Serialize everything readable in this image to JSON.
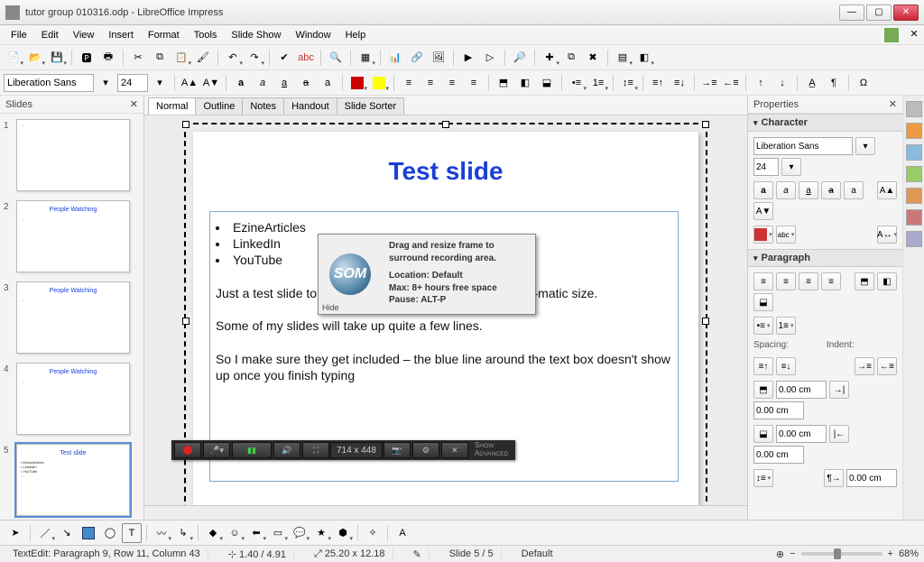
{
  "window": {
    "title": "tutor group 010316.odp - LibreOffice Impress"
  },
  "menu": [
    "File",
    "Edit",
    "View",
    "Insert",
    "Format",
    "Tools",
    "Slide Show",
    "Window",
    "Help"
  ],
  "format_toolbar": {
    "font": "Liberation Sans",
    "size": "24"
  },
  "slides_panel": {
    "title": "Slides"
  },
  "thumbs": [
    {
      "num": "1",
      "title": "",
      "body": ""
    },
    {
      "num": "2",
      "title": "People Watching",
      "body": ""
    },
    {
      "num": "3",
      "title": "People Watching",
      "body": ""
    },
    {
      "num": "4",
      "title": "People Watching",
      "body": ""
    },
    {
      "num": "5",
      "title": "Test slide",
      "body": "",
      "selected": true
    }
  ],
  "view_tabs": [
    "Normal",
    "Outline",
    "Notes",
    "Handout",
    "Slide Sorter"
  ],
  "active_view": "Normal",
  "slide": {
    "title": "Test slide",
    "bullets": [
      "EzineArticles",
      "LinkedIn",
      "YouTube"
    ],
    "para1": "Just a test slide to show you the size of the Screencast-o-matic size.",
    "para2": "Some of my slides will take up quite a few lines.",
    "para3": "So I make sure they get included – the blue line around the text box doesn't show up once you finish typing"
  },
  "som": {
    "logo": "SOM",
    "line1": "Drag and resize frame to surround recording area.",
    "loc": "Location: Default",
    "max": "Max: 8+ hours free space",
    "pause": "Pause: ALT-P",
    "hide": "Hide"
  },
  "recbar": {
    "dims": "714 x 448",
    "advanced": "SHOW\nADVANCED"
  },
  "properties": {
    "title": "Properties",
    "character": {
      "title": "Character",
      "font": "Liberation Sans",
      "size": "24"
    },
    "paragraph": {
      "title": "Paragraph",
      "spacing_label": "Spacing:",
      "indent_label": "Indent:",
      "above": "0.00 cm",
      "left": "0.00 cm",
      "below": "0.00 cm",
      "right": "0.00 cm",
      "first": "0.00 cm"
    }
  },
  "status": {
    "edit": "TextEdit: Paragraph 9, Row 11, Column 43",
    "pos": "1.40 / 4.91",
    "size": "25.20 x 12.18",
    "slide": "Slide 5 / 5",
    "layout": "Default",
    "zoom": "68%"
  }
}
